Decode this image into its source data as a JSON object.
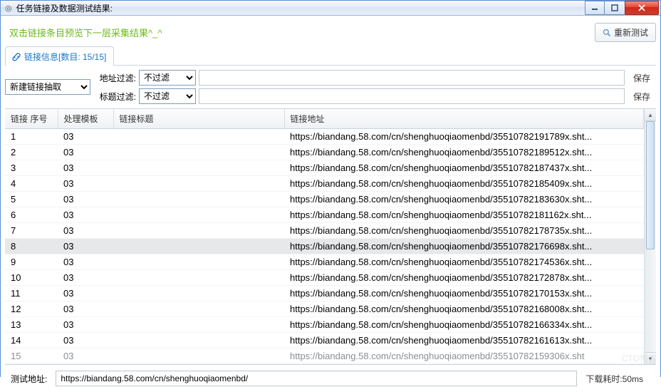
{
  "window": {
    "title": "任务链接及数据测试结果:"
  },
  "hint": "双击链接条目预览下一层采集结果^_^",
  "retest_label": "重新测试",
  "tab": {
    "label": "链接信息[数目: 15/15]"
  },
  "filters": {
    "extract_select": "新建链接抽取",
    "addr_label": "地址过滤:",
    "title_label": "标题过滤:",
    "addr_select": "不过滤",
    "title_select": "不过滤",
    "addr_value": "",
    "title_value": "",
    "save_label": "保存"
  },
  "columns": {
    "seq": "链接 序号",
    "tpl": "处理模板",
    "title": "链接标题",
    "addr": "链接地址"
  },
  "rows": [
    {
      "seq": "1",
      "tpl": "03",
      "title": "",
      "addr": "https://biandang.58.com/cn/shenghuoqiaomenbd/35510782191789x.sht..."
    },
    {
      "seq": "2",
      "tpl": "03",
      "title": "",
      "addr": "https://biandang.58.com/cn/shenghuoqiaomenbd/35510782189512x.sht..."
    },
    {
      "seq": "3",
      "tpl": "03",
      "title": "",
      "addr": "https://biandang.58.com/cn/shenghuoqiaomenbd/35510782187437x.sht..."
    },
    {
      "seq": "4",
      "tpl": "03",
      "title": "",
      "addr": "https://biandang.58.com/cn/shenghuoqiaomenbd/35510782185409x.sht..."
    },
    {
      "seq": "5",
      "tpl": "03",
      "title": "",
      "addr": "https://biandang.58.com/cn/shenghuoqiaomenbd/35510782183630x.sht..."
    },
    {
      "seq": "6",
      "tpl": "03",
      "title": "",
      "addr": "https://biandang.58.com/cn/shenghuoqiaomenbd/35510782181162x.sht..."
    },
    {
      "seq": "7",
      "tpl": "03",
      "title": "",
      "addr": "https://biandang.58.com/cn/shenghuoqiaomenbd/35510782178735x.sht..."
    },
    {
      "seq": "8",
      "tpl": "03",
      "title": "",
      "addr": "https://biandang.58.com/cn/shenghuoqiaomenbd/35510782176698x.sht..."
    },
    {
      "seq": "9",
      "tpl": "03",
      "title": "",
      "addr": "https://biandang.58.com/cn/shenghuoqiaomenbd/35510782174536x.sht..."
    },
    {
      "seq": "10",
      "tpl": "03",
      "title": "",
      "addr": "https://biandang.58.com/cn/shenghuoqiaomenbd/35510782172878x.sht..."
    },
    {
      "seq": "11",
      "tpl": "03",
      "title": "",
      "addr": "https://biandang.58.com/cn/shenghuoqiaomenbd/35510782170153x.sht..."
    },
    {
      "seq": "12",
      "tpl": "03",
      "title": "",
      "addr": "https://biandang.58.com/cn/shenghuoqiaomenbd/35510782168008x.sht..."
    },
    {
      "seq": "13",
      "tpl": "03",
      "title": "",
      "addr": "https://biandang.58.com/cn/shenghuoqiaomenbd/35510782166334x.sht..."
    },
    {
      "seq": "14",
      "tpl": "03",
      "title": "",
      "addr": "https://biandang.58.com/cn/shenghuoqiaomenbd/35510782161613x.sht..."
    },
    {
      "seq": "15",
      "tpl": "03",
      "title": "",
      "addr": "https://biandang.58.com/cn/shenghuoqiaomenbd/35510782159306x.sht"
    }
  ],
  "selected_index": 7,
  "status": {
    "label": "测试地址:",
    "value": "https://biandang.58.com/cn/shenghuoqiaomenbd/",
    "time": "下载耗时:50ms"
  },
  "watermark": "CTO博客"
}
